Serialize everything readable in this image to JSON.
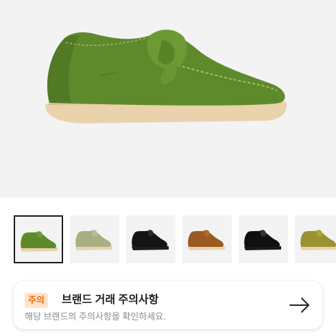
{
  "product": {
    "main_image": "green suede moccasin shoe",
    "main_color": "#5f8a2c",
    "thumbnails": [
      {
        "name": "green",
        "color": "#5f8a2c",
        "selected": true
      },
      {
        "name": "sage",
        "color": "#a9ae83",
        "selected": false
      },
      {
        "name": "black-suede",
        "color": "#141414",
        "selected": false
      },
      {
        "name": "cola-brown",
        "color": "#9a5a22",
        "selected": false
      },
      {
        "name": "black-leather",
        "color": "#0f0f0f",
        "selected": false
      },
      {
        "name": "olive",
        "color": "#9a9230",
        "selected": false
      }
    ]
  },
  "notice": {
    "badge": "주의",
    "title": "브랜드 거래 주의사항",
    "description": "해당 브랜드의 주의사항을 확인하세요.",
    "accent": "#ef6c00",
    "arrow_icon": "arrow-right-icon"
  }
}
